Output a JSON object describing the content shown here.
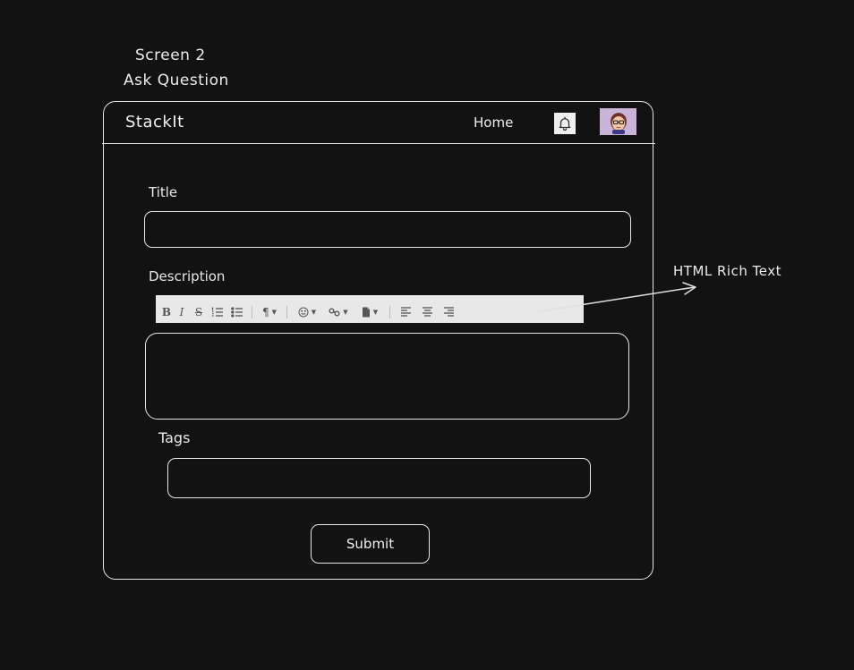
{
  "header": {
    "screen_label": "Screen 2",
    "screen_subtitle": "Ask Question"
  },
  "navbar": {
    "brand": "StackIt",
    "home_link": "Home",
    "notification_icon": "bell-icon",
    "avatar_icon": "user-avatar"
  },
  "form": {
    "title_label": "Title",
    "title_value": "",
    "description_label": "Description",
    "description_value": "",
    "tags_label": "Tags",
    "tags_value": "",
    "submit_label": "Submit"
  },
  "editor_toolbar": {
    "bold": "B",
    "italic": "I",
    "strikethrough": "S",
    "buttons": [
      "bold",
      "italic",
      "strikethrough",
      "ordered-list",
      "unordered-list",
      "paragraph",
      "emoji",
      "link",
      "file",
      "align-left",
      "align-center",
      "align-right"
    ]
  },
  "annotation": {
    "text": "HTML Rich Text"
  },
  "colors": {
    "background": "#121212",
    "stroke": "#e6e6e6",
    "toolbar": "#e8e8e8",
    "avatar_bg": "#c7b4d8"
  }
}
